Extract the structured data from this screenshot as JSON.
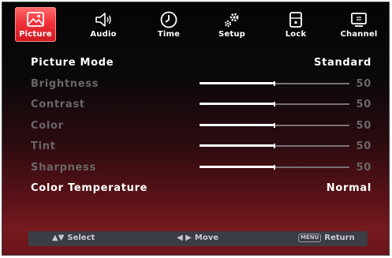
{
  "tabs": [
    {
      "label": "Picture",
      "icon": "picture-icon",
      "active": true
    },
    {
      "label": "Audio",
      "icon": "speaker-icon",
      "active": false
    },
    {
      "label": "Time",
      "icon": "clock-icon",
      "active": false
    },
    {
      "label": "Setup",
      "icon": "gears-icon",
      "active": false
    },
    {
      "label": "Lock",
      "icon": "lock-icon",
      "active": false
    },
    {
      "label": "Channel",
      "icon": "tv-icon",
      "active": false
    }
  ],
  "menu": {
    "picture_mode": {
      "label": "Picture Mode",
      "value": "Standard"
    },
    "brightness": {
      "label": "Brightness",
      "value": "50",
      "level": 0.5
    },
    "contrast": {
      "label": "Contrast",
      "value": "50",
      "level": 0.5
    },
    "color": {
      "label": "Color",
      "value": "50",
      "level": 0.5
    },
    "tint": {
      "label": "Tint",
      "value": "50",
      "level": 0.5
    },
    "sharpness": {
      "label": "Sharpness",
      "value": "50",
      "level": 0.5
    },
    "color_temperature": {
      "label": "Color Temperature",
      "value": "Normal"
    }
  },
  "footer": {
    "select_label": "Select",
    "select_glyph": "▲▼",
    "move_label": "Move",
    "move_glyph": "◀ ▶",
    "menu_key": "MENU",
    "return_label": "Return"
  },
  "colors": {
    "active_tab": "#e8303a",
    "background_top": "#050506",
    "background_bottom": "#751a1f",
    "dim_text": "#6a6668",
    "footer_bar": "#3b3d44"
  }
}
